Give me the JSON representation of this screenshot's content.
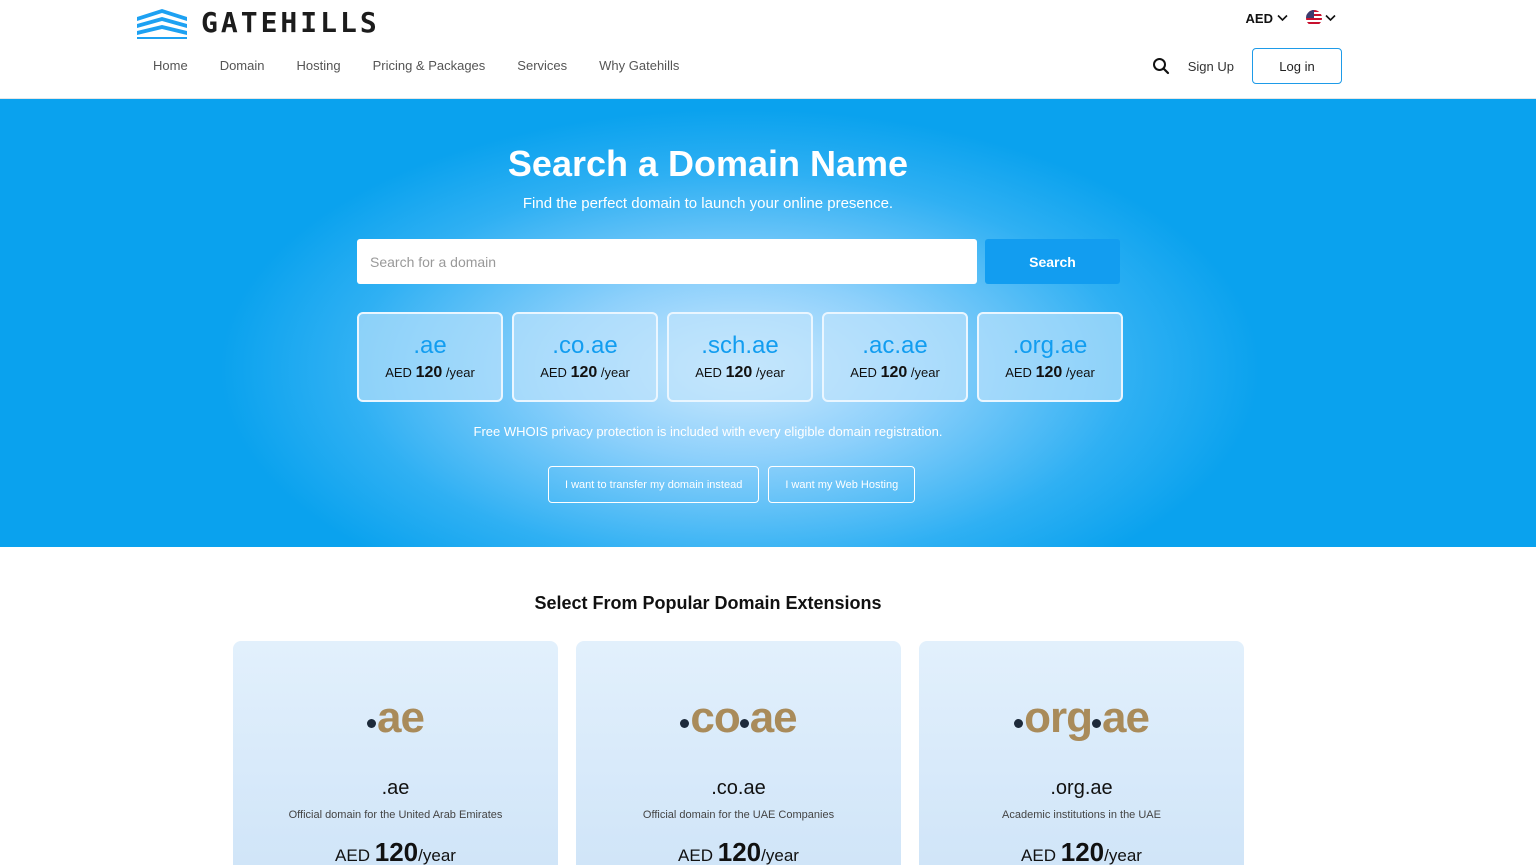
{
  "brand": {
    "name": "GATEHILLS"
  },
  "header": {
    "currency": "AED",
    "nav": [
      "Home",
      "Domain",
      "Hosting",
      "Pricing & Packages",
      "Services",
      "Why Gatehills"
    ],
    "signup": "Sign Up",
    "login": "Log in"
  },
  "hero": {
    "title": "Search a Domain Name",
    "subtitle": "Find the perfect domain to launch your online presence.",
    "search_placeholder": "Search for a domain",
    "search_button": "Search",
    "tlds": [
      {
        "name": ".ae",
        "currency": "AED",
        "price": "120",
        "period": "/year"
      },
      {
        "name": ".co.ae",
        "currency": "AED",
        "price": "120",
        "period": "/year"
      },
      {
        "name": ".sch.ae",
        "currency": "AED",
        "price": "120",
        "period": "/year"
      },
      {
        "name": ".ac.ae",
        "currency": "AED",
        "price": "120",
        "period": "/year"
      },
      {
        "name": ".org.ae",
        "currency": "AED",
        "price": "120",
        "period": "/year"
      }
    ],
    "whois_note": "Free WHOIS privacy protection is included with every eligible domain registration.",
    "transfer_button": "I want to transfer my domain instead",
    "hosting_button": "I want my Web Hosting"
  },
  "popular": {
    "title": "Select From Popular Domain Extensions",
    "cards": [
      {
        "logo_parts": [
          "ae"
        ],
        "name": ".ae",
        "desc": "Official domain for the United Arab Emirates",
        "currency": "AED",
        "price": "120",
        "period": "/year"
      },
      {
        "logo_parts": [
          "co",
          "ae"
        ],
        "name": ".co.ae",
        "desc": "Official domain for the UAE Companies",
        "currency": "AED",
        "price": "120",
        "period": "/year"
      },
      {
        "logo_parts": [
          "org",
          "ae"
        ],
        "name": ".org.ae",
        "desc": "Academic institutions in the UAE",
        "currency": "AED",
        "price": "120",
        "period": "/year"
      }
    ]
  },
  "colors": {
    "accent": "#129df0",
    "hero_bg": "#0aa2ee",
    "logo_gold": "#a98b5a"
  }
}
